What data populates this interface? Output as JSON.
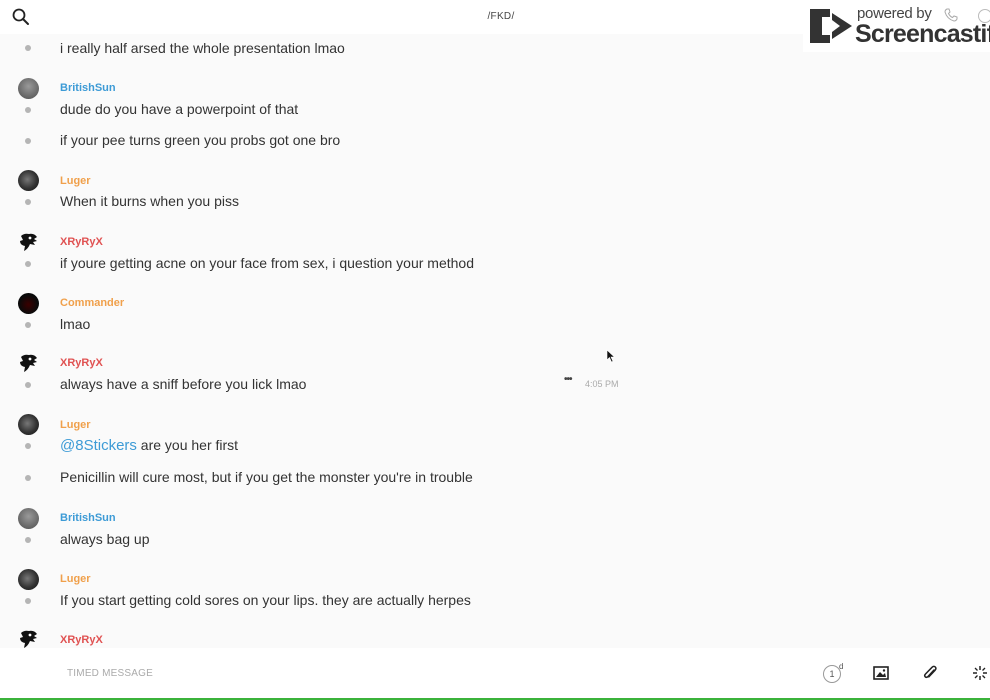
{
  "header": {
    "channel_title": "/FKD/"
  },
  "watermark": {
    "powered_by": "powered by",
    "brand": "Screencastify"
  },
  "messages": [
    {
      "text": "i really half arsed the whole presentation lmao"
    },
    {
      "username": "BritishSun",
      "text": "dude do you have a powerpoint of that"
    },
    {
      "text": "if your pee turns green you probs got one bro"
    },
    {
      "username": "Luger",
      "text": "When it burns when you piss"
    },
    {
      "username": "XRyRyX",
      "text": "if youre getting acne on your face from sex, i question your method"
    },
    {
      "username": "Commander",
      "text": "lmao"
    },
    {
      "username": "XRyRyX",
      "text": "always have a sniff before you lick lmao",
      "time": "4:05 PM",
      "more": "•••"
    },
    {
      "username": "Luger",
      "mention": "@8Stickers",
      "text": " are you her first"
    },
    {
      "text": "Penicillin will cure most, but if you get the monster you're in trouble"
    },
    {
      "username": "BritishSun",
      "text": "always bag up"
    },
    {
      "username": "Luger",
      "text": "If you start getting cold sores on your lips. they are actually herpes"
    },
    {
      "username": "XRyRyX"
    }
  ],
  "composer": {
    "placeholder": "TIMED MESSAGE",
    "timer_value": "1",
    "timer_unit": "d"
  },
  "colors": {
    "mention": "#3d9bd6",
    "user_blue": "#3d9bd6",
    "user_orange": "#f0a04b",
    "user_red": "#e05252",
    "accent_bar": "#3bb33b"
  }
}
